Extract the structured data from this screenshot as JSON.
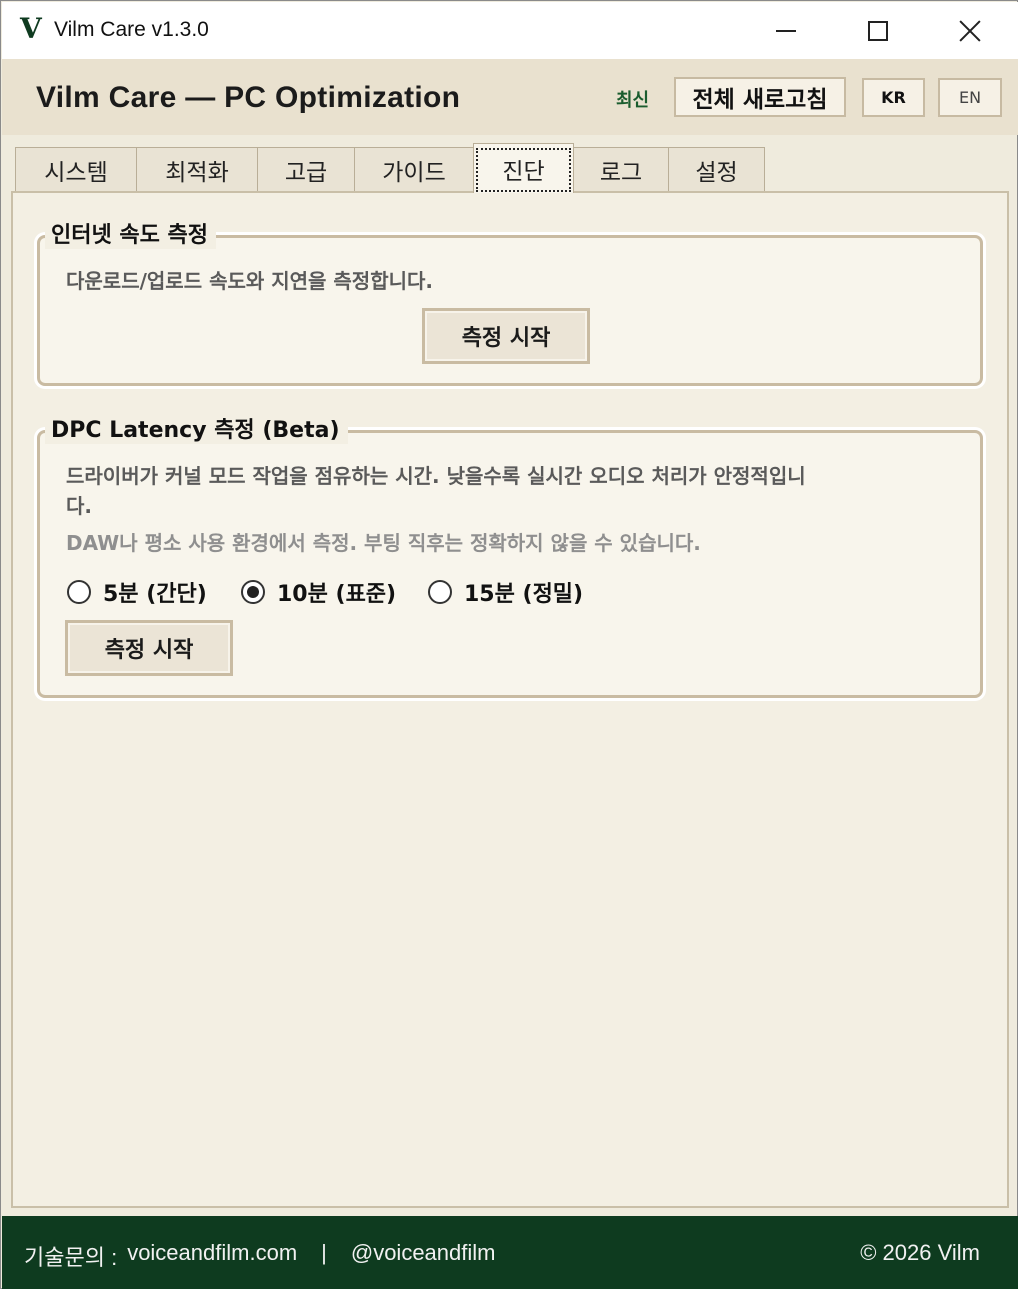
{
  "window": {
    "logo": "V",
    "title": "Vilm Care v1.3.0"
  },
  "header": {
    "title": "Vilm Care — PC Optimization",
    "latest_label": "최신",
    "refresh_all": "전체 새로고침",
    "lang_kr": "KR",
    "lang_en": "EN"
  },
  "tabs": [
    {
      "label": "시스템"
    },
    {
      "label": "최적화"
    },
    {
      "label": "고급"
    },
    {
      "label": "가이드"
    },
    {
      "label": "진단",
      "active": true
    },
    {
      "label": "로그"
    },
    {
      "label": "설정"
    }
  ],
  "speed_test": {
    "title": "인터넷 속도 측정",
    "description": "다운로드/업로드 속도와 지연을 측정합니다.",
    "start_button": "측정 시작"
  },
  "dpc": {
    "title": "DPC Latency 측정 (Beta)",
    "description_line1": "드라이버가 커널 모드 작업을 점유하는 시간. 낮을수록 실시간 오디오 처리가 안정적입니",
    "description_line2": "다.",
    "note": "DAW나 평소 사용 환경에서 측정. 부팅 직후는 정확하지 않을 수 있습니다.",
    "options": [
      {
        "label": "5분 (간단)",
        "checked": false
      },
      {
        "label": "10분 (표준)",
        "checked": true
      },
      {
        "label": "15분 (정밀)",
        "checked": false
      }
    ],
    "start_button": "측정 시작"
  },
  "footer": {
    "support_label": "기술문의 :",
    "website": "voiceandfilm.com",
    "separator": "|",
    "handle": "@voiceandfilm",
    "copyright": "© 2026 Vilm"
  },
  "colors": {
    "brand_green": "#0e3b1f",
    "latest_green": "#1a5c2e",
    "header_bg": "#e9e1cf",
    "border_tan": "#c9bba2"
  }
}
